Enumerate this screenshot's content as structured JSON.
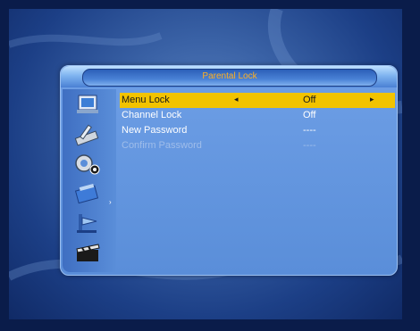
{
  "window": {
    "title": "Parental Lock"
  },
  "rows": [
    {
      "label": "Menu Lock",
      "value": "Off",
      "state": "selected"
    },
    {
      "label": "Channel Lock",
      "value": "Off",
      "state": "active"
    },
    {
      "label": "New Password",
      "value": "----",
      "state": "active"
    },
    {
      "label": "Confirm Password",
      "value": "----",
      "state": "disabled"
    }
  ],
  "sidebar": {
    "icons": [
      "installation-icon",
      "system-tools-icon",
      "settings-gears-icon",
      "channel-icon",
      "media-icon",
      "clapper-icon"
    ],
    "active_arrow": "›"
  },
  "arrows": {
    "left": "◂",
    "right": "▸"
  },
  "colors": {
    "highlight": "#f2c300",
    "title_text": "#ffb020",
    "panel": "#5a8ed9",
    "disabled_text": "#9fbdea"
  }
}
